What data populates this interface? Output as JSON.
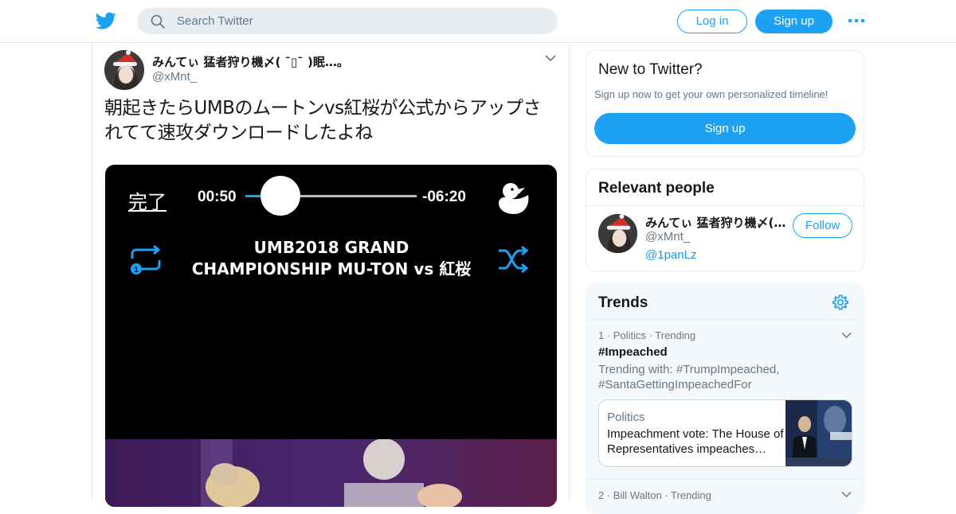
{
  "topbar": {
    "logo_icon": "twitter-bird-icon",
    "search_placeholder": "Search Twitter",
    "login_label": "Log in",
    "signup_label": "Sign up",
    "more_icon": "more-dots-icon"
  },
  "tweet": {
    "display_name": "みんてぃ 猛者狩り機〆( ¯▯¯ )眠…。",
    "handle": "@xMnt_",
    "text": "朝起きたらUMBのムートンvs紅桜が公式からアップされてて速攻ダウンロードしたよね",
    "media": {
      "done_label": "完了",
      "time_elapsed": "00:50",
      "time_remaining": "-06:20",
      "progress_fraction": 0.12,
      "title_line1": "UMB2018 GRAND",
      "title_line2": "CHAMPIONSHIP  MU-TON vs 紅桜"
    }
  },
  "new_to_twitter": {
    "title": "New to Twitter?",
    "subtitle": "Sign up now to get your own personalized timeline!",
    "button_label": "Sign up"
  },
  "relevant_people": {
    "title": "Relevant people",
    "person": {
      "name": "みんてぃ 猛者狩り機〆(…",
      "handle": "@xMnt_",
      "bio_link": "@1panLz",
      "follow_label": "Follow"
    }
  },
  "trends": {
    "title": "Trends",
    "items": [
      {
        "meta": "1 · Politics · Trending",
        "tag": "#Impeached",
        "trending_with": "Trending with: #TrumpImpeached, #SantaGettingImpeachedFor",
        "news": {
          "category": "Politics",
          "headline": "Impeachment vote: The House of Representatives impeaches…"
        }
      },
      {
        "meta": "2 · Bill Walton · Trending"
      }
    ]
  },
  "colors": {
    "brand_blue": "#1da1f2",
    "link_blue": "#1b95e0",
    "secondary_text": "#657786",
    "border": "#e1e8ed",
    "trends_bg": "#f5f8fa"
  }
}
